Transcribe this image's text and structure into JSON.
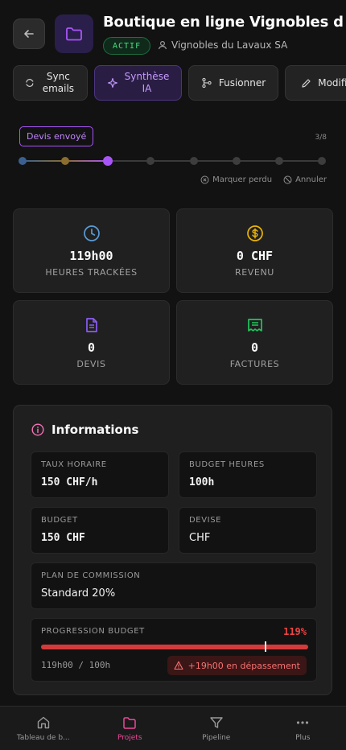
{
  "header": {
    "title": "Boutique en ligne Vignobles d...",
    "status": "ACTIF",
    "client": "Vignobles du Lavaux SA"
  },
  "actions": [
    {
      "label": "Sync emails",
      "icon": "sync-icon"
    },
    {
      "label": "Synthèse IA",
      "icon": "sparkle-icon"
    },
    {
      "label": "Fusionner",
      "icon": "merge-icon"
    },
    {
      "label": "Modifier",
      "icon": "pencil-icon"
    }
  ],
  "pipeline": {
    "stage": "Devis envoyé",
    "progress": "3/8",
    "current_step": 3,
    "total_steps": 8,
    "step_colors": [
      "#3b5f8f",
      "#8a6d2f",
      "#a855f7"
    ],
    "mark_lost": "Marquer perdu",
    "cancel": "Annuler"
  },
  "stats": [
    {
      "value": "119h00",
      "label": "HEURES TRACKÉES",
      "icon": "clock-icon",
      "color": "#5b9bd5"
    },
    {
      "value": "0 CHF",
      "label": "REVENU",
      "icon": "dollar-icon",
      "color": "#eab308"
    },
    {
      "value": "0",
      "label": "DEVIS",
      "icon": "document-icon",
      "color": "#8b5cf6"
    },
    {
      "value": "0",
      "label": "FACTURES",
      "icon": "receipt-icon",
      "color": "#22c55e"
    }
  ],
  "info": {
    "title": "Informations",
    "taux_label": "TAUX HORAIRE",
    "taux_value": "150 CHF/h",
    "budget_heures_label": "BUDGET HEURES",
    "budget_heures_value": "100h",
    "budget_label": "BUDGET",
    "budget_value": "150 CHF",
    "devise_label": "DEVISE",
    "devise_value": "CHF",
    "plan_label": "PLAN DE COMMISSION",
    "plan_value": "Standard 20%",
    "progress_label": "PROGRESSION BUDGET",
    "progress_percent": "119%",
    "progress_ratio": 1.19,
    "progress_detail": "119h00 / 100h",
    "overrun": "+19h00 en dépassement"
  },
  "nav": [
    {
      "label": "Tableau de b...",
      "icon": "home-icon",
      "active": false
    },
    {
      "label": "Projets",
      "icon": "folder-icon",
      "active": true
    },
    {
      "label": "Pipeline",
      "icon": "filter-icon",
      "active": false
    },
    {
      "label": "Plus",
      "icon": "more-icon",
      "active": false
    }
  ]
}
